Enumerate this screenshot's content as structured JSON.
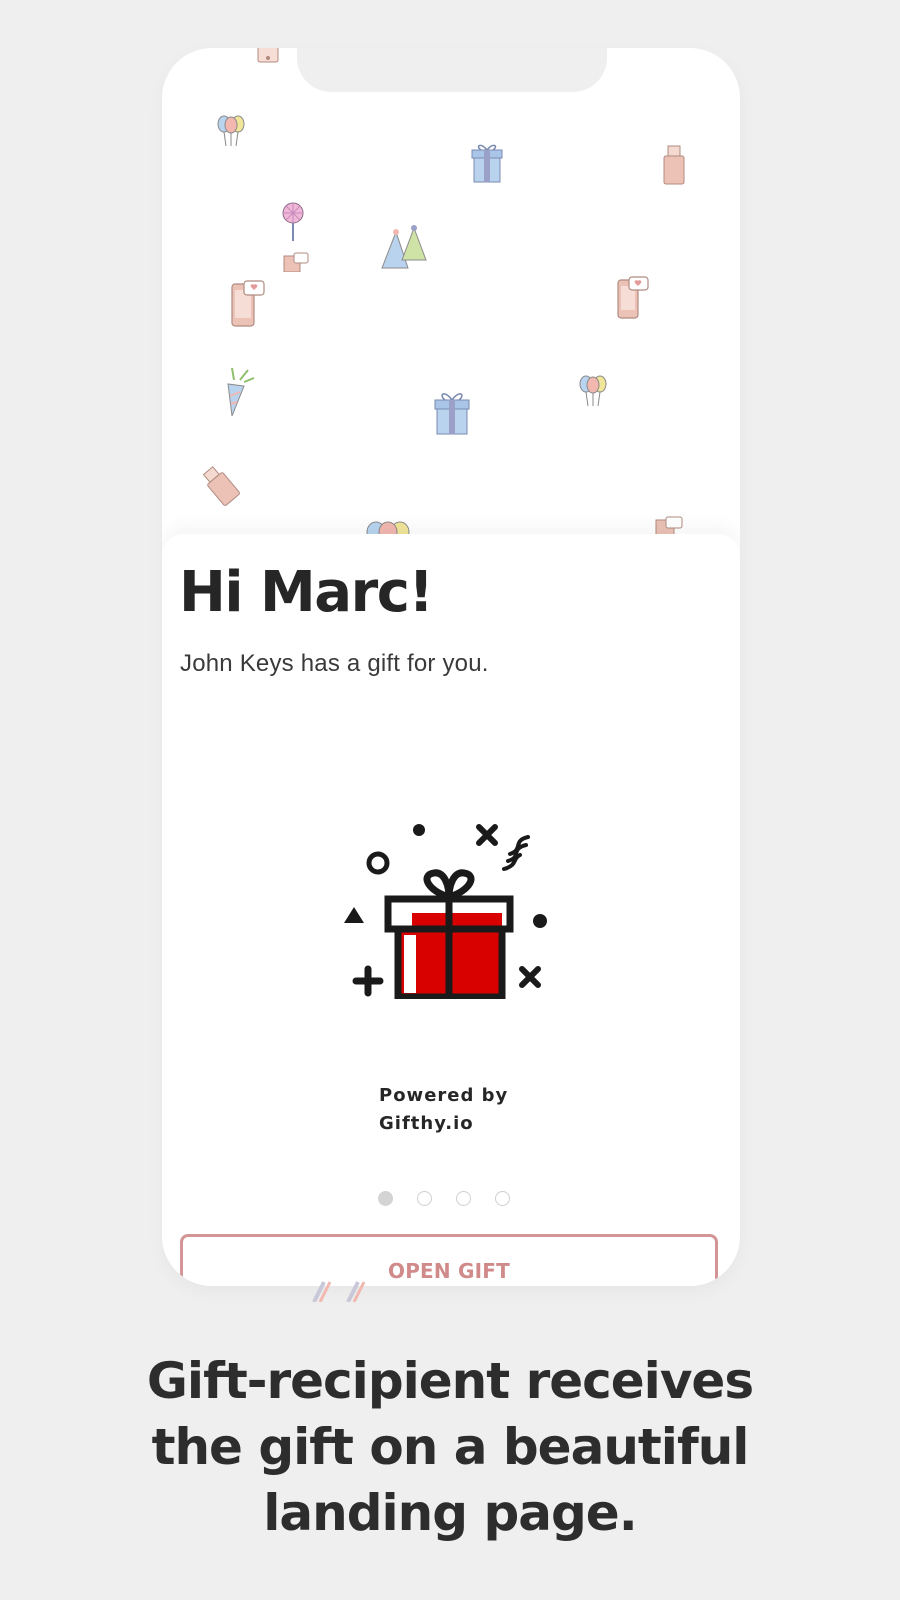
{
  "page": {
    "background": "#efefef"
  },
  "card": {
    "greeting": "Hi Marc!",
    "message": "John Keys has a gift for you.",
    "powered_by": [
      "Powered by",
      "Gifthy.io"
    ],
    "open_button_label": "OPEN GIFT",
    "carousel_dot_count": 4,
    "carousel_active_index": 0,
    "illustration_icon": "gift-box-icon"
  },
  "background_pattern_icons": [
    "balloons-icon",
    "gift-box-icon",
    "usb-drive-icon",
    "lollipop-icon",
    "party-hats-icon",
    "phone-heart-icon",
    "party-popper-icon"
  ],
  "caption": {
    "line1": "Gift-recipient receives",
    "line2": "the gift on a beautiful",
    "line3": "landing page."
  },
  "colors": {
    "accent": "#d39595",
    "gift_red": "#d90000",
    "text_dark": "#262626"
  }
}
